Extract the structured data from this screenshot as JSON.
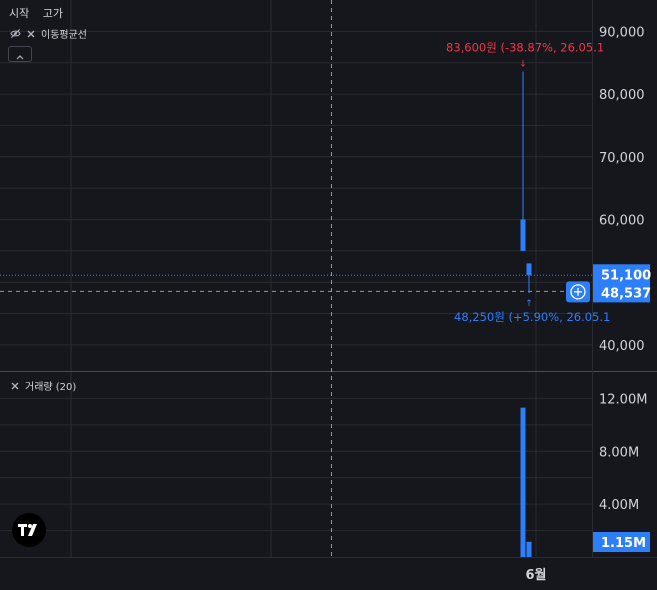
{
  "header": {
    "open_label": "시작",
    "high_label": "고가"
  },
  "indicators": {
    "price_pane": {
      "name": "이동평균선",
      "hide_icon": "eye-off-icon",
      "close_icon": "close-icon"
    },
    "volume_pane": {
      "name": "거래량 (20)",
      "close_icon": "close-icon"
    },
    "collapse_icon": "chevron-up-icon"
  },
  "logo": {
    "name": "tradingview-logo",
    "text": "TV"
  },
  "colors": {
    "background": "#16171d",
    "up": "#2d7ff9",
    "down": "#f23645",
    "grid": "#2a2b31",
    "axis_text": "#d1d4dc",
    "label_bg": "#2d7ff9"
  },
  "chart_data": {
    "type": "candlestick",
    "price_axis": {
      "ticks": [
        40000,
        50000,
        60000,
        70000,
        80000,
        90000
      ],
      "tick_labels": [
        "40,000",
        "50,000",
        "60,000",
        "70,000",
        "80,000",
        "90,000"
      ],
      "range": [
        36000,
        95000
      ]
    },
    "volume_axis": {
      "ticks": [
        4000000,
        8000000,
        12000000
      ],
      "tick_labels": [
        "4.00M",
        "8.00M",
        "12.00M"
      ],
      "range": [
        0,
        14000000
      ]
    },
    "x_axis": {
      "labels": [
        "6월"
      ]
    },
    "candles": [
      {
        "open": 55000,
        "high": 83600,
        "low": 55000,
        "close": 60000
      },
      {
        "open": 51100,
        "high": 53000,
        "low": 48250,
        "close": 53000
      }
    ],
    "volumes": [
      {
        "value": 11300000
      },
      {
        "value": 1150000
      }
    ],
    "annotations": {
      "high": {
        "text": "83,600원 (-38.87%, 26.05.1",
        "value": 83600
      },
      "low": {
        "text": "48,250원 (+5.90%, 26.05.1",
        "value": 48250
      }
    },
    "last_price": {
      "value": 51100,
      "label": "51,100"
    },
    "crosshair": {
      "value": 48537,
      "label": "48,537",
      "plus_icon": "plus-circle-icon"
    },
    "last_volume": {
      "value": 1150000,
      "label": "1.15M"
    }
  }
}
